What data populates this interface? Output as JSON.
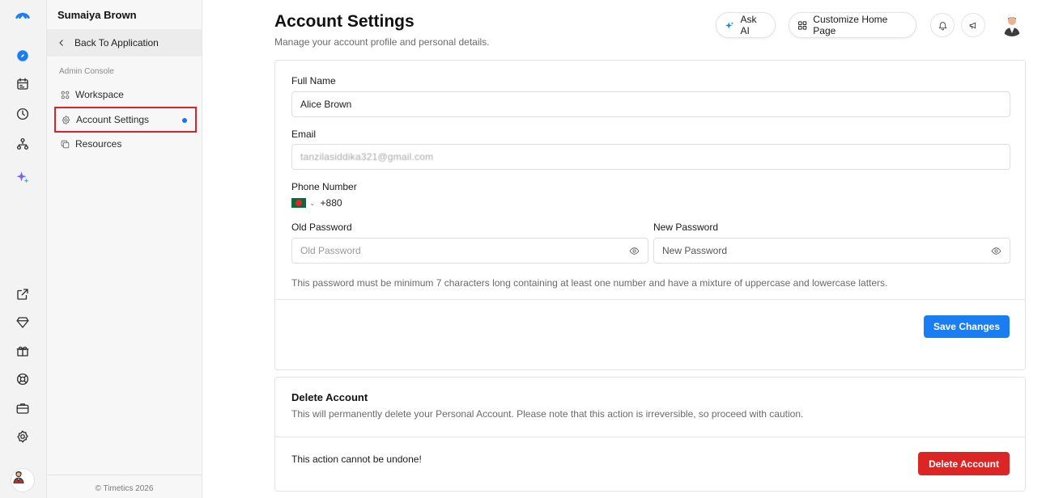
{
  "sidebar": {
    "user_name": "Sumaiya Brown",
    "back_label": "Back To Application",
    "section_label": "Admin Console",
    "items": [
      {
        "label": "Workspace",
        "icon": "grid-icon"
      },
      {
        "label": "Account Settings",
        "icon": "gear-icon",
        "active": true
      },
      {
        "label": "Resources",
        "icon": "copy-icon"
      }
    ],
    "copyright": "© Timetics 2026"
  },
  "rail": {
    "icons": [
      "logo-icon",
      "compass-icon",
      "calendar-icon",
      "clock-icon",
      "hierarchy-icon",
      "sparkle-icon",
      "external-link-icon",
      "diamond-icon",
      "gift-icon",
      "support-icon",
      "briefcase-icon",
      "settings-icon"
    ]
  },
  "header": {
    "title": "Account Settings",
    "subtitle": "Manage your account profile and personal details.",
    "ask_ai_label": "Ask AI",
    "customize_label": "Customize Home Page"
  },
  "form": {
    "full_name_label": "Full Name",
    "full_name_value": "Alice Brown",
    "email_label": "Email",
    "email_value": "tanzilasiddika321@gmail.com",
    "phone_label": "Phone Number",
    "phone_code": "+880",
    "old_password_label": "Old Password",
    "old_password_placeholder": "Old Password",
    "new_password_label": "New Password",
    "new_password_placeholder": "New Password",
    "password_hint": "This password must be minimum 7 characters long containing at least one number and have a mixture of uppercase and lowercase latters.",
    "save_label": "Save Changes"
  },
  "delete": {
    "title": "Delete Account",
    "description": "This will permanently delete your Personal Account. Please note that this action is irreversible, so proceed with caution.",
    "warning": "This action cannot be undone!",
    "button_label": "Delete Account"
  },
  "colors": {
    "primary": "#1a7ef2",
    "danger": "#dc2626",
    "active_outline": "#d9222a"
  }
}
